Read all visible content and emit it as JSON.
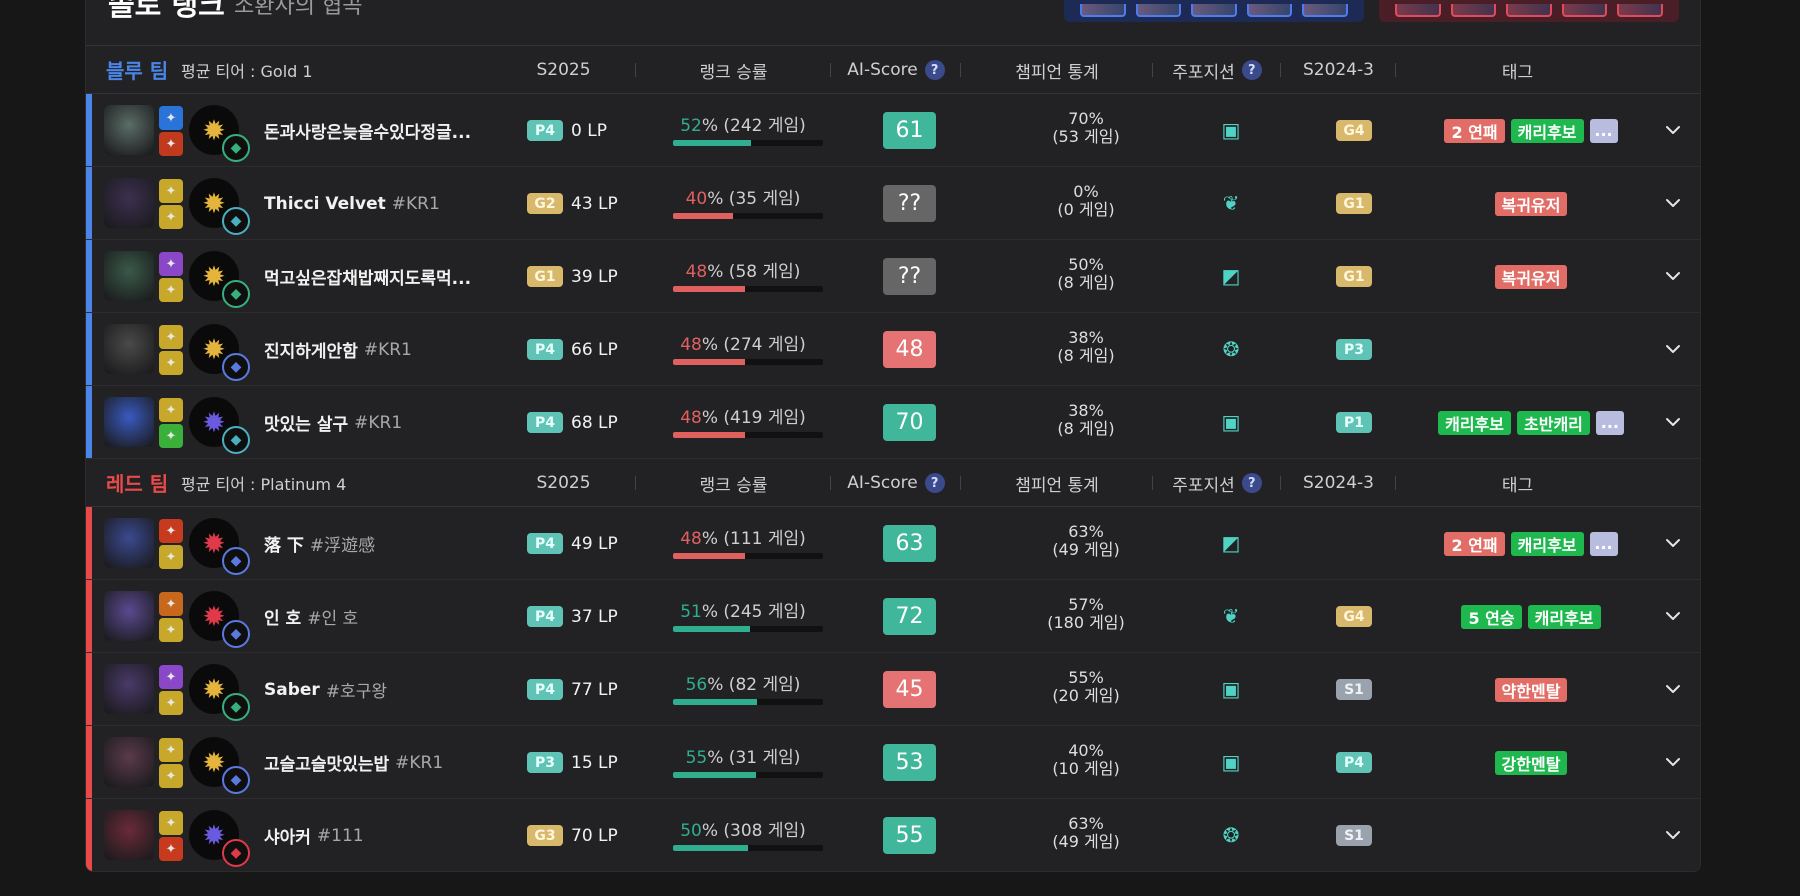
{
  "title": "솔로 랭크",
  "subtitle": "소환사의 협곡",
  "columns": {
    "season": "S2025",
    "winrate": "랭크 승률",
    "ai_score": "AI-Score",
    "champ_stats": "챔피언 통계",
    "position": "주포지션",
    "prev_season": "S2024-3",
    "tags": "태그",
    "help": "?"
  },
  "colors": {
    "blue_team": "#4a86e8",
    "red_team": "#e84a4a",
    "green": "#2fae90",
    "red": "#e06060",
    "score_green": "#40b79a",
    "score_red": "#e57373",
    "score_unknown": "#666666"
  },
  "blue_team": {
    "name": "블루 팀",
    "avg": "평균 티어 : Gold 1",
    "players": [
      {
        "name": "돈과사랑은늦을수있다정글...",
        "tag": "",
        "portrait": "#5b6d67",
        "spell1": "#2a74d9",
        "spell2": "#c23a1d",
        "rune": "#e4b43c",
        "rune_sub": "#38b07e",
        "tier": "P4",
        "lp": "0 LP",
        "wr_pct": "52",
        "wr_games": "% (242 게임)",
        "wr_value": 52,
        "wr_good": true,
        "score": "61",
        "score_type": "green",
        "cs_pct": "70%",
        "cs_games": "(53 게임)",
        "pos": "jungle",
        "prev_tier": "G4",
        "tags": [
          {
            "t": "2 연패",
            "c": "red"
          },
          {
            "t": "캐리후보",
            "c": "green"
          },
          {
            "t": "...",
            "c": "more"
          }
        ]
      },
      {
        "name": "Thicci Velvet",
        "tag": "#KR1",
        "portrait": "#3c3050",
        "spell1": "#c8a82a",
        "spell2": "#c8a82a",
        "rune": "#e4b43c",
        "rune_sub": "#4ab0c0",
        "tier": "G2",
        "lp": "43 LP",
        "wr_pct": "40",
        "wr_games": "% (35 게임)",
        "wr_value": 40,
        "wr_good": false,
        "score": "??",
        "score_type": "unknown",
        "cs_pct": "0%",
        "cs_games": "(0 게임)",
        "pos": "support",
        "prev_tier": "G1",
        "tags": [
          {
            "t": "복귀유저",
            "c": "red"
          }
        ]
      },
      {
        "name": "먹고싶은잡채밥째지도록먹...",
        "tag": "",
        "portrait": "#3a5a4a",
        "spell1": "#8a48c8",
        "spell2": "#c8a82a",
        "rune": "#e4b43c",
        "rune_sub": "#38b07e",
        "tier": "G1",
        "lp": "39 LP",
        "wr_pct": "48",
        "wr_games": "% (58 게임)",
        "wr_value": 48,
        "wr_good": false,
        "score": "??",
        "score_type": "unknown",
        "cs_pct": "50%",
        "cs_games": "(8 게임)",
        "pos": "top",
        "prev_tier": "G1",
        "tags": [
          {
            "t": "복귀유저",
            "c": "red"
          }
        ]
      },
      {
        "name": "진지하게안함",
        "tag": "#KR1",
        "portrait": "#4a4a4a",
        "spell1": "#c8a82a",
        "spell2": "#c8a82a",
        "rune": "#e4b43c",
        "rune_sub": "#5a7ae0",
        "tier": "P4",
        "lp": "66 LP",
        "wr_pct": "48",
        "wr_games": "% (274 게임)",
        "wr_value": 48,
        "wr_good": false,
        "score": "48",
        "score_type": "red",
        "cs_pct": "38%",
        "cs_games": "(8 게임)",
        "pos": "mid",
        "prev_tier": "P3",
        "tags": []
      },
      {
        "name": "맛있는 살구",
        "tag": "#KR1",
        "portrait": "#3a5ac0",
        "spell1": "#c8a82a",
        "spell2": "#3ab03a",
        "rune": "#6a5ae0",
        "rune_sub": "#4ab0c0",
        "tier": "P4",
        "lp": "68 LP",
        "wr_pct": "48",
        "wr_games": "% (419 게임)",
        "wr_value": 48,
        "wr_good": false,
        "score": "70",
        "score_type": "green",
        "cs_pct": "38%",
        "cs_games": "(8 게임)",
        "pos": "bottom",
        "prev_tier": "P1",
        "tags": [
          {
            "t": "캐리후보",
            "c": "green"
          },
          {
            "t": "초반캐리",
            "c": "green"
          },
          {
            "t": "...",
            "c": "more"
          }
        ]
      }
    ]
  },
  "red_team": {
    "name": "레드 팀",
    "avg": "평균 티어 : Platinum 4",
    "players": [
      {
        "name": "落 下",
        "tag": "#浮遊感",
        "portrait": "#3a4a90",
        "spell1": "#c83a1d",
        "spell2": "#c8a82a",
        "rune": "#e03a4a",
        "rune_sub": "#5a7ae0",
        "tier": "P4",
        "lp": "49 LP",
        "wr_pct": "48",
        "wr_games": "% (111 게임)",
        "wr_value": 48,
        "wr_good": false,
        "score": "63",
        "score_type": "green",
        "cs_pct": "63%",
        "cs_games": "(49 게임)",
        "pos": "top",
        "prev_tier": "",
        "tags": [
          {
            "t": "2 연패",
            "c": "red"
          },
          {
            "t": "캐리후보",
            "c": "green"
          },
          {
            "t": "...",
            "c": "more"
          }
        ]
      },
      {
        "name": "인 호",
        "tag": "#인 호",
        "portrait": "#5a4a90",
        "spell1": "#c8681d",
        "spell2": "#c8a82a",
        "rune": "#e03a4a",
        "rune_sub": "#5a7ae0",
        "tier": "P4",
        "lp": "37 LP",
        "wr_pct": "51",
        "wr_games": "% (245 게임)",
        "wr_value": 51,
        "wr_good": true,
        "score": "72",
        "score_type": "green",
        "cs_pct": "57%",
        "cs_games": "(180 게임)",
        "pos": "support",
        "prev_tier": "G4",
        "tags": [
          {
            "t": "5 연승",
            "c": "green"
          },
          {
            "t": "캐리후보",
            "c": "green"
          }
        ]
      },
      {
        "name": "Saber",
        "tag": "#호구왕",
        "portrait": "#4a3a6a",
        "spell1": "#8a48c8",
        "spell2": "#c8a82a",
        "rune": "#e4b43c",
        "rune_sub": "#38b07e",
        "tier": "P4",
        "lp": "77 LP",
        "wr_pct": "56",
        "wr_games": "% (82 게임)",
        "wr_value": 56,
        "wr_good": true,
        "score": "45",
        "score_type": "red",
        "cs_pct": "55%",
        "cs_games": "(20 게임)",
        "pos": "jungle",
        "prev_tier": "S1",
        "tags": [
          {
            "t": "약한멘탈",
            "c": "red"
          }
        ]
      },
      {
        "name": "고슬고슬맛있는밥",
        "tag": "#KR1",
        "portrait": "#5a3a4a",
        "spell1": "#c8a82a",
        "spell2": "#c8a82a",
        "rune": "#e4b43c",
        "rune_sub": "#5a7ae0",
        "tier": "P3",
        "lp": "15 LP",
        "wr_pct": "55",
        "wr_games": "% (31 게임)",
        "wr_value": 55,
        "wr_good": true,
        "score": "53",
        "score_type": "green",
        "cs_pct": "40%",
        "cs_games": "(10 게임)",
        "pos": "bottom",
        "prev_tier": "P4",
        "tags": [
          {
            "t": "강한멘탈",
            "c": "green"
          }
        ]
      },
      {
        "name": "샤아커",
        "tag": "#111",
        "portrait": "#6a2a3a",
        "spell1": "#c8a82a",
        "spell2": "#c83a1d",
        "rune": "#6a5ae0",
        "rune_sub": "#e03a4a",
        "tier": "G3",
        "lp": "70 LP",
        "wr_pct": "50",
        "wr_games": "% (308 게임)",
        "wr_value": 50,
        "wr_good": true,
        "score": "55",
        "score_type": "green",
        "cs_pct": "63%",
        "cs_games": "(49 게임)",
        "pos": "mid",
        "prev_tier": "S1",
        "tags": []
      }
    ]
  }
}
